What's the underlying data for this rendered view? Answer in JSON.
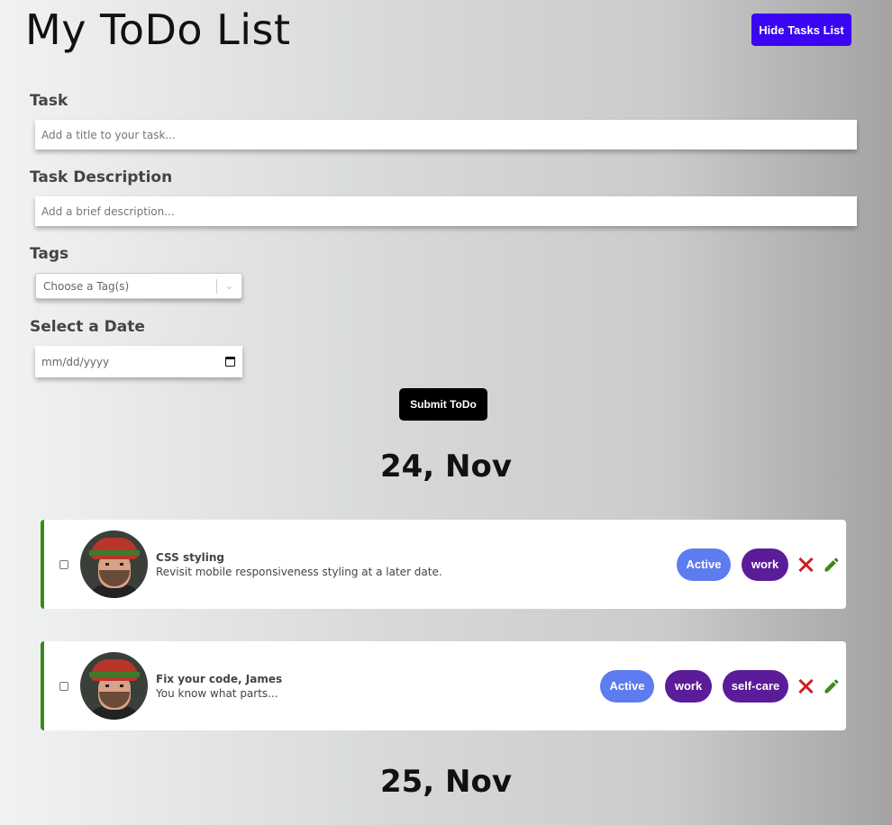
{
  "header": {
    "title": "My ToDo List",
    "hide_button": "Hide Tasks List"
  },
  "form": {
    "task_label": "Task",
    "task_placeholder": "Add a title to your task...",
    "desc_label": "Task Description",
    "desc_placeholder": "Add a brief description...",
    "tags_label": "Tags",
    "tags_placeholder": "Choose a Tag(s)",
    "date_label": "Select a Date",
    "date_placeholder": "mm/dd/yyyy",
    "submit": "Submit ToDo"
  },
  "groups": [
    {
      "date": "24, Nov",
      "tasks": [
        {
          "title": "CSS styling",
          "description": "Revisit mobile responsiveness styling at a later date.",
          "status": "Active",
          "tags": [
            "work"
          ]
        },
        {
          "title": "Fix your code, James",
          "description": "You know what parts...",
          "status": "Active",
          "tags": [
            "work",
            "self-care"
          ]
        }
      ]
    },
    {
      "date": "25, Nov",
      "tasks": []
    }
  ],
  "icons": {
    "delete": "close-x-icon",
    "edit": "pencil-icon",
    "date": "calendar-icon",
    "select": "chevron-down-icon"
  },
  "colors": {
    "hide_button": "#3a05f2",
    "status_pill": "#5c7cf0",
    "tag_pill": "#5b1c9a",
    "delete": "#d02020",
    "edit": "#3b8a1a",
    "card_accent": "#3b8a1a"
  }
}
